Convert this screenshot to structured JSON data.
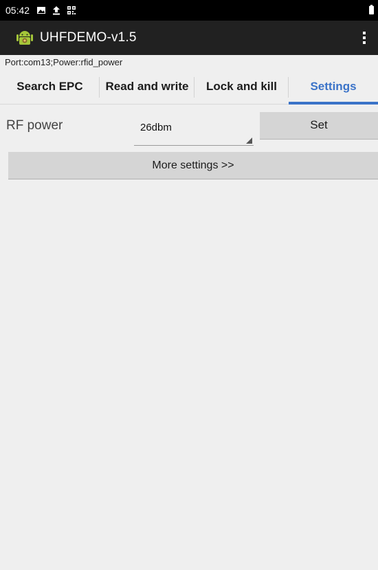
{
  "status_bar": {
    "time": "05:42",
    "icons": [
      "image-notification-icon",
      "upload-icon",
      "qr-code-icon",
      "battery-icon"
    ]
  },
  "app_bar": {
    "title": "UHFDEMO-v1.5",
    "app_icon": "android-app-icon",
    "overflow_icon": "overflow-menu-icon"
  },
  "port_info": "Port:com13;Power:rfid_power",
  "tabs": [
    {
      "label": "Search EPC",
      "active": false
    },
    {
      "label": "Read and write",
      "active": false
    },
    {
      "label": "Lock and kill",
      "active": false
    },
    {
      "label": "Settings",
      "active": true
    }
  ],
  "rf_power": {
    "label": "RF power",
    "selected_value": "26dbm",
    "set_label": "Set"
  },
  "more_settings_label": "More settings >>",
  "colors": {
    "accent": "#3b73c8",
    "app_bar": "#212121",
    "status_bar": "#000000",
    "background": "#efefef",
    "button": "#d5d5d5"
  }
}
